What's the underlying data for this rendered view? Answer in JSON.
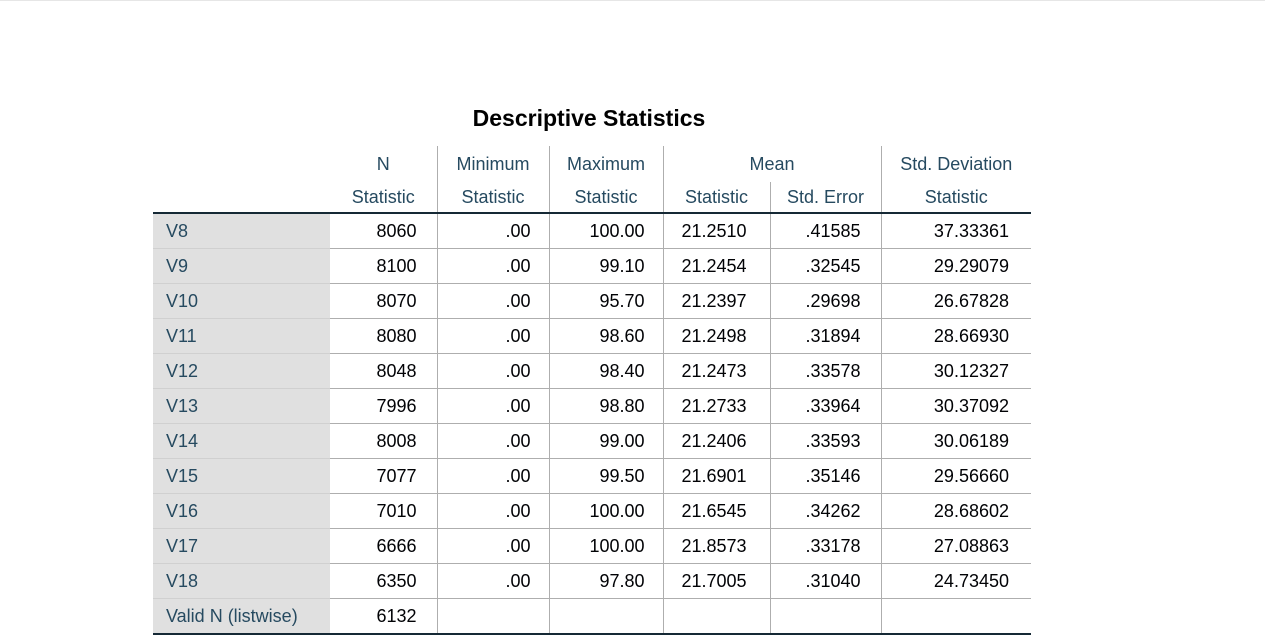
{
  "title": "Descriptive Statistics",
  "headers": {
    "top": [
      "N",
      "Minimum",
      "Maximum",
      "Mean",
      "Std. Deviation"
    ],
    "sub": [
      "Statistic",
      "Statistic",
      "Statistic",
      "Statistic",
      "Std. Error",
      "Statistic"
    ]
  },
  "rows": [
    {
      "label": "V8",
      "n": "8060",
      "min": ".00",
      "max": "100.00",
      "mean": "21.2510",
      "se": ".41585",
      "sd": "37.33361"
    },
    {
      "label": "V9",
      "n": "8100",
      "min": ".00",
      "max": "99.10",
      "mean": "21.2454",
      "se": ".32545",
      "sd": "29.29079"
    },
    {
      "label": "V10",
      "n": "8070",
      "min": ".00",
      "max": "95.70",
      "mean": "21.2397",
      "se": ".29698",
      "sd": "26.67828"
    },
    {
      "label": "V11",
      "n": "8080",
      "min": ".00",
      "max": "98.60",
      "mean": "21.2498",
      "se": ".31894",
      "sd": "28.66930"
    },
    {
      "label": "V12",
      "n": "8048",
      "min": ".00",
      "max": "98.40",
      "mean": "21.2473",
      "se": ".33578",
      "sd": "30.12327"
    },
    {
      "label": "V13",
      "n": "7996",
      "min": ".00",
      "max": "98.80",
      "mean": "21.2733",
      "se": ".33964",
      "sd": "30.37092"
    },
    {
      "label": "V14",
      "n": "8008",
      "min": ".00",
      "max": "99.00",
      "mean": "21.2406",
      "se": ".33593",
      "sd": "30.06189"
    },
    {
      "label": "V15",
      "n": "7077",
      "min": ".00",
      "max": "99.50",
      "mean": "21.6901",
      "se": ".35146",
      "sd": "29.56660"
    },
    {
      "label": "V16",
      "n": "7010",
      "min": ".00",
      "max": "100.00",
      "mean": "21.6545",
      "se": ".34262",
      "sd": "28.68602"
    },
    {
      "label": "V17",
      "n": "6666",
      "min": ".00",
      "max": "100.00",
      "mean": "21.8573",
      "se": ".33178",
      "sd": "27.08863"
    },
    {
      "label": "V18",
      "n": "6350",
      "min": ".00",
      "max": "97.80",
      "mean": "21.7005",
      "se": ".31040",
      "sd": "24.73450"
    },
    {
      "label": "Valid N (listwise)",
      "n": "6132",
      "min": "",
      "max": "",
      "mean": "",
      "se": "",
      "sd": ""
    }
  ]
}
